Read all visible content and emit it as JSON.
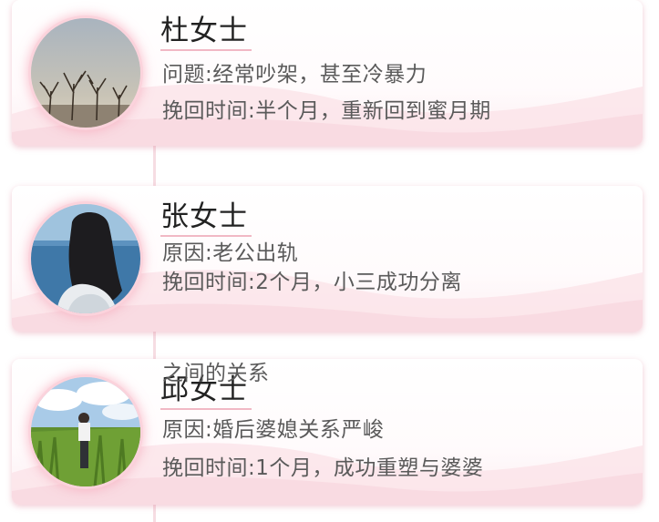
{
  "cards": [
    {
      "name": "张女士",
      "line1": "原因:老公出轨",
      "line2": "挽回时间:2个月，小三成功分离"
    },
    {
      "name": "邱女士",
      "line1": "原因:婚后婆媳关系严峻",
      "line2": "挽回时间:1个月，成功重塑与婆婆",
      "line3": "之间的关系"
    },
    {
      "name": "杜女士",
      "line1": "问题:经常吵架，甚至冷暴力",
      "line2": "挽回时间:半个月，重新回到蜜月期"
    }
  ],
  "colors": {
    "accent_pink": "#f1b8c5",
    "card_shadow": "#db7891",
    "text_dark": "#222222",
    "text_gray": "#5a5a5a"
  }
}
